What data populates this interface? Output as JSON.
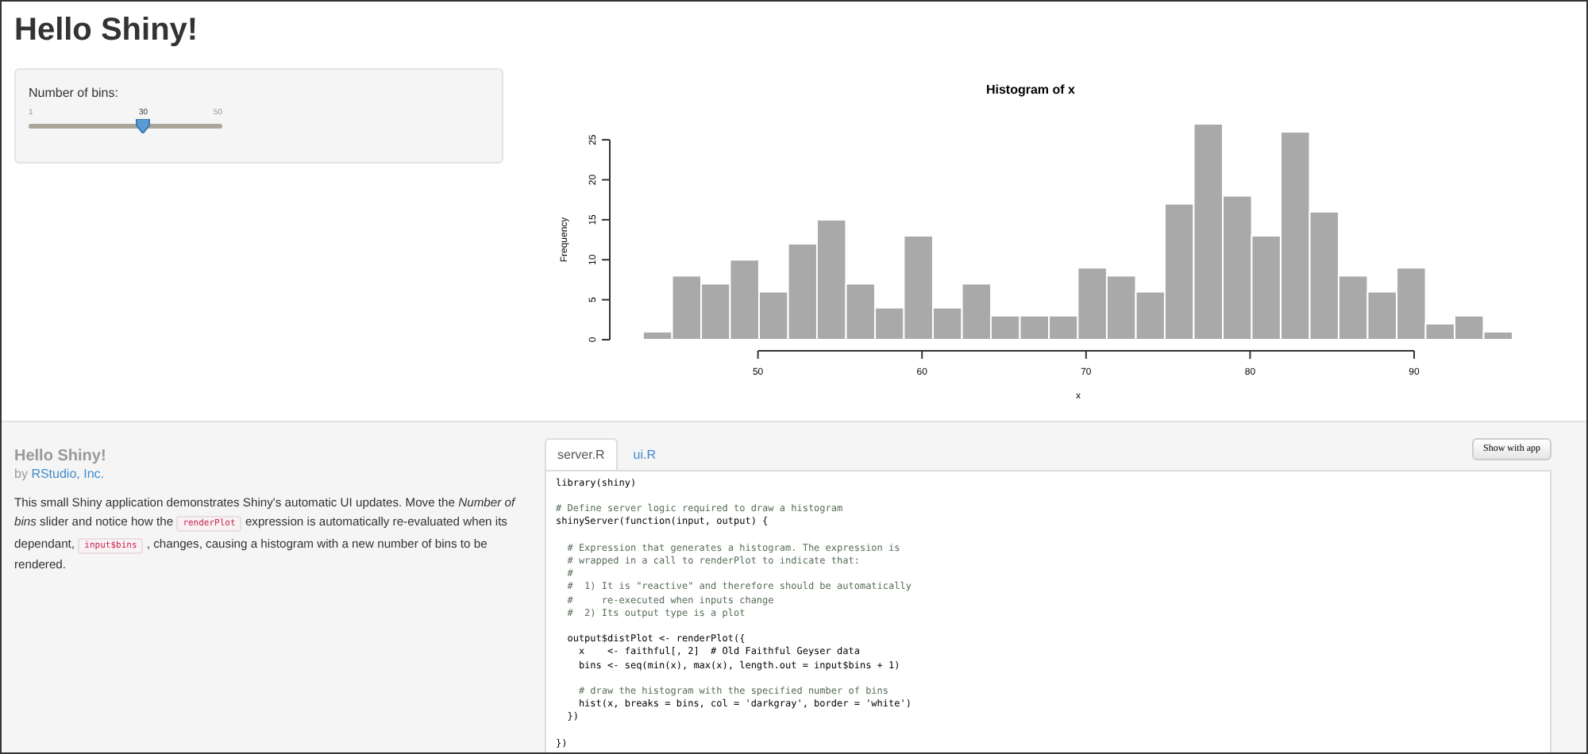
{
  "title": "Hello Shiny!",
  "slider": {
    "label": "Number of bins:",
    "min": "1",
    "max": "50",
    "value": "30",
    "level": 0.592
  },
  "chart_data": {
    "type": "bar",
    "title": "Histogram of x",
    "xlabel": "x",
    "ylabel": "Frequency",
    "xlim": [
      43,
      96
    ],
    "ylim": [
      0,
      27
    ],
    "xticks": [
      50,
      60,
      70,
      80,
      90
    ],
    "yticks": [
      0,
      5,
      10,
      15,
      20,
      25
    ],
    "x": [
      43.88,
      45.65,
      47.42,
      49.18,
      50.95,
      52.72,
      54.48,
      56.25,
      58.02,
      59.78,
      61.55,
      63.32,
      65.08,
      66.85,
      68.62,
      70.38,
      72.15,
      73.92,
      75.68,
      77.45,
      79.22,
      80.98,
      82.75,
      84.52,
      86.28,
      88.05,
      89.82,
      91.58,
      93.35,
      95.12
    ],
    "values": [
      1,
      8,
      7,
      10,
      6,
      12,
      15,
      7,
      4,
      13,
      4,
      7,
      3,
      3,
      3,
      9,
      8,
      6,
      17,
      27,
      18,
      13,
      26,
      16,
      8,
      6,
      9,
      2,
      3,
      1
    ]
  },
  "about": {
    "heading": "Hello Shiny!",
    "by": "by",
    "author": "RStudio, Inc.",
    "description": [
      {
        "kind": "text",
        "text": "This small Shiny application demonstrates Shiny's automatic UI updates. Move the *Number of bins* slider and notice how the"
      },
      {
        "kind": "code",
        "text": "renderPlot"
      },
      {
        "kind": "text",
        "text": "expression is automatically re-evaluated when its dependant,"
      },
      {
        "kind": "code",
        "text": "input$bins"
      },
      {
        "kind": "text",
        "text": ", changes, causing a histogram with a new number of bins to be rendered."
      }
    ]
  },
  "tabs": [
    {
      "label": "server.R",
      "selected": true
    },
    {
      "label": "ui.R",
      "selected": false
    }
  ],
  "show_button": "Show with app",
  "code": [
    {
      "kind": "code",
      "text": "library(shiny)"
    },
    {
      "kind": "comment",
      "text": "# Define server logic required to draw a histogram",
      "gap_before": true
    },
    {
      "kind": "code",
      "text": "shinyServer(function(input, output) {"
    },
    {
      "kind": "comment",
      "text": "  # Expression that generates a histogram. The expression is",
      "gap_before": true
    },
    {
      "kind": "comment",
      "text": "  # wrapped in a call to renderPlot to indicate that:"
    },
    {
      "kind": "comment",
      "text": "  #"
    },
    {
      "kind": "comment",
      "text": "  #  1) It is \"reactive\" and therefore should be automatically"
    },
    {
      "kind": "comment",
      "text": "  #     re-executed when inputs change"
    },
    {
      "kind": "comment",
      "text": "  #  2) Its output type is a plot"
    },
    {
      "kind": "code",
      "text": "  output$distPlot <- renderPlot({",
      "gap_before": true
    },
    {
      "kind": "code",
      "text": "    x    <- faithful[, 2]  # Old Faithful Geyser data"
    },
    {
      "kind": "code",
      "text": "    bins <- seq(min(x), max(x), length.out = input$bins + 1)"
    },
    {
      "kind": "comment",
      "text": "    # draw the histogram with the specified number of bins",
      "gap_before": true
    },
    {
      "kind": "code",
      "text": "    hist(x, breaks = bins, col = 'darkgray', border = 'white')"
    },
    {
      "kind": "code",
      "text": "  })"
    },
    {
      "kind": "code",
      "text": "})",
      "gap_before": true
    }
  ]
}
